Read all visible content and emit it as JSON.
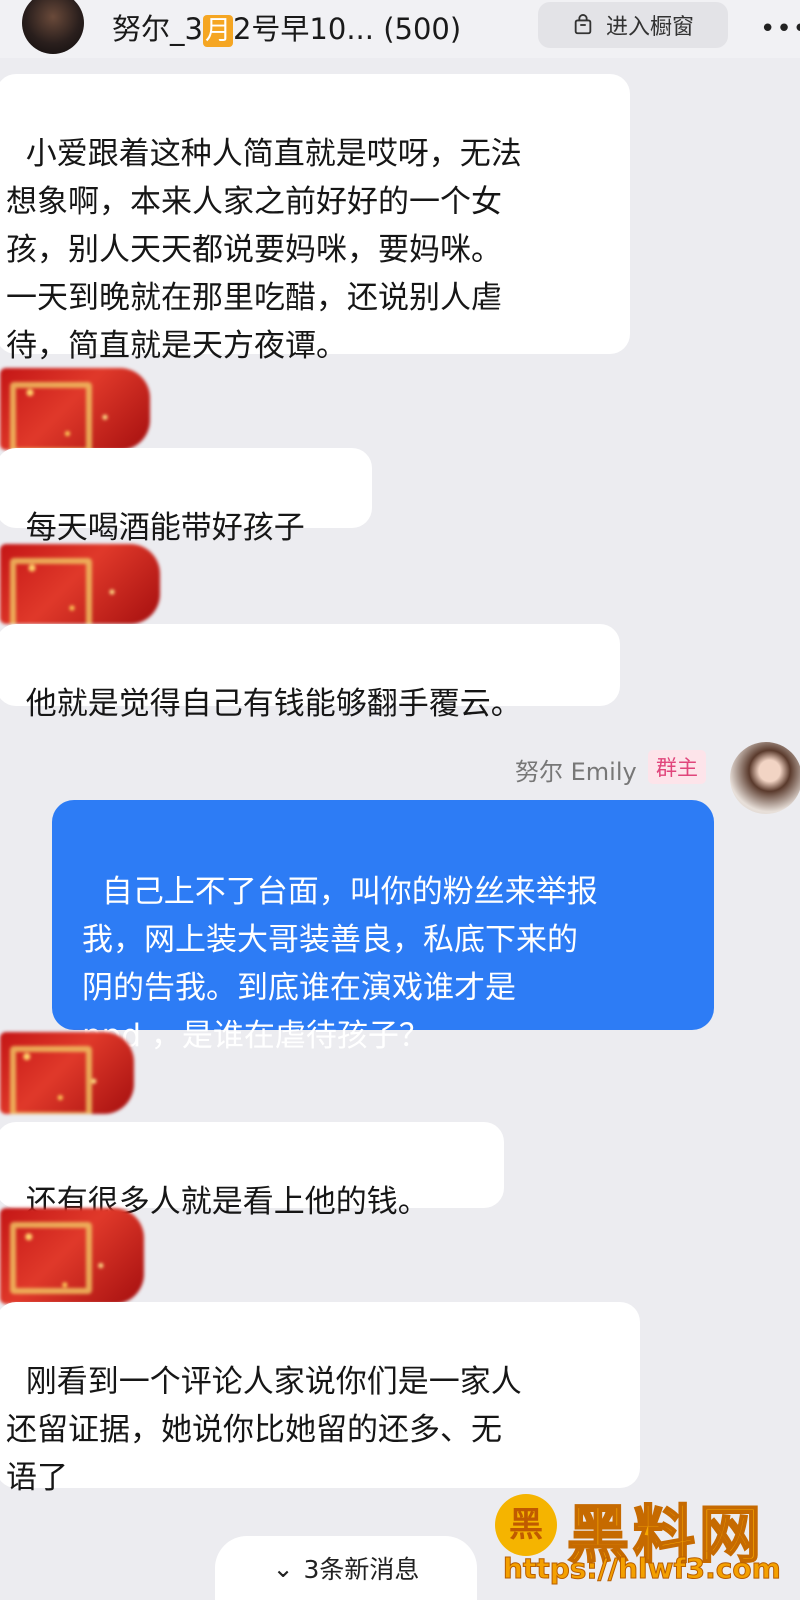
{
  "header": {
    "title_prefix": "努尔_3",
    "title_badge": "月",
    "title_suffix": "2号早10... (500)",
    "shop_label": "进入橱窗",
    "more": "•••"
  },
  "messages": [
    {
      "text": "小爱跟着这种人简直就是哎呀，无法\n想象啊，本来人家之前好好的一个女\n孩，别人天天都说要妈咪，要妈咪。\n一天到晚就在那里吃醋，还说别人虐\n待，简直就是天方夜谭。"
    },
    {
      "text": "每天喝酒能带好孩子"
    },
    {
      "text": "他就是觉得自己有钱能够翻手覆云。"
    },
    {
      "text": "还有很多人就是看上他的钱。"
    },
    {
      "text": "刚看到一个评论人家说你们是一家人\n还留证据，她说你比她留的还多、无\n语了"
    }
  ],
  "my_message": {
    "sender": "努尔 Emily",
    "badge": "群主",
    "text": "自己上不了台面，叫你的粉丝来举报\n我，网上装大哥装善良，私底下来的\n阴的告我。到底谁在演戏谁才是\nnpd ，是谁在虐待孩子？"
  },
  "new_messages": {
    "icon": "⌄",
    "label": "3条新消息"
  },
  "watermark": {
    "logo": "黑",
    "title": "黑料网",
    "url": "https://hlwf3.com"
  },
  "colors": {
    "background": "#ececf0",
    "my_bubble": "#2d7cf5",
    "owner_badge_text": "#e0457b",
    "watermark": "#f7a800"
  }
}
